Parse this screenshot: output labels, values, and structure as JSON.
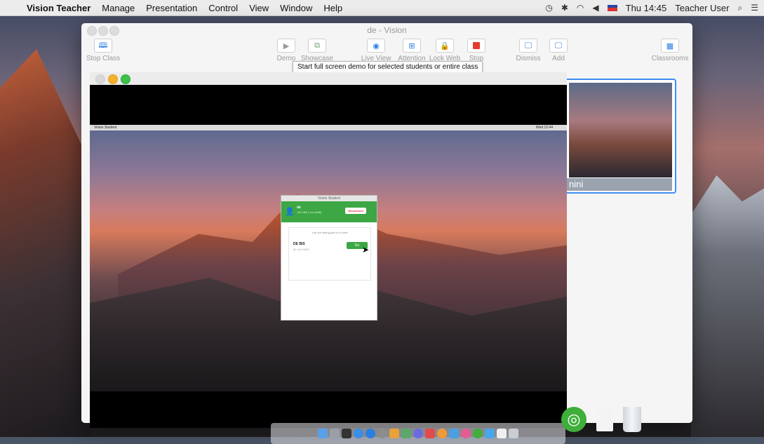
{
  "menubar": {
    "app_name": "Vision Teacher",
    "items": [
      "Manage",
      "Presentation",
      "Control",
      "View",
      "Window",
      "Help"
    ],
    "clock": "Thu 14:45",
    "user": "Teacher User"
  },
  "window": {
    "title": "de - Vision",
    "toolbar": {
      "stop_class": "Stop Class",
      "demo": "Demo",
      "showcase": "Showcase",
      "live_view": "Live View",
      "attention": "Attention",
      "lock_web": "Lock Web",
      "stop": "Stop",
      "dismiss": "Dismiss",
      "add": "Add",
      "classrooms": "Classrooms"
    },
    "tooltip": "Start full screen demo for selected students or entire class",
    "thumbnail": {
      "caption": "nini"
    }
  },
  "student_screen": {
    "menubar_app": "Vision Student",
    "clock": "Wed 12:44",
    "app": {
      "title": "Vision Student",
      "name": "de",
      "subtitle": "192.168.1.xxx (Wifi)",
      "disconnect": "Disconnect",
      "panel_title": "You are taking part in a class",
      "class_name": "DE BIS",
      "class_id": "ID: 0x0 0000",
      "go_label": "Go"
    }
  },
  "colors": {
    "accent_blue": "#2a7de1",
    "stop_red": "#e53a2f",
    "student_green": "#3ca744"
  }
}
